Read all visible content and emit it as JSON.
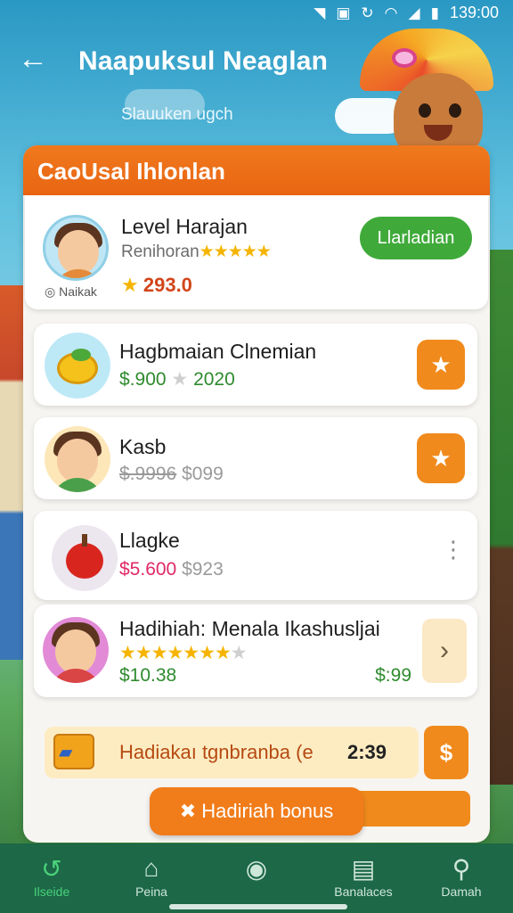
{
  "status_bar": {
    "time": "139:00",
    "icons": [
      "notification-icon",
      "app-icon",
      "sync-icon",
      "wifi-icon",
      "signal-icon",
      "battery-icon"
    ]
  },
  "header": {
    "back_icon": "arrow-left-icon",
    "title": "Naapuksul Neaglan",
    "subtitle": "Slauuken ugch"
  },
  "panel": {
    "title": "CaoUsal Ihlonlan",
    "featured": {
      "title": "Level Harajan",
      "subtitle": "Renihoran",
      "stars": "★★★★★",
      "rating_icon": "★",
      "rating": "293.0",
      "badge": "◎ Naikak",
      "button": "Llarladian"
    },
    "items": [
      {
        "title": "Hagbmaian Clnemian",
        "price": "$.900",
        "star": "★",
        "year": "2020",
        "action_icon": "★"
      },
      {
        "title": "Kasb",
        "price_old": "$.9996",
        "price_new": "$099",
        "action_icon": "★"
      },
      {
        "title": "Llagke",
        "price": "$5.600",
        "price_old": "$923",
        "action_icon": "⋮"
      },
      {
        "title": "Hadihiah: Menala Ikashusljai",
        "stars_on": "★★★★★★★",
        "stars_off": "★",
        "price": "$10.38",
        "price_right": "$:99",
        "action_icon": "›"
      }
    ],
    "bonus_bar": {
      "text": "Hadiakaı tgnbranba (e",
      "time": "2:39",
      "dollar_label": "$"
    },
    "bonus_button": {
      "icon": "✖",
      "label": "Hadiriah bonus"
    }
  },
  "bottom_nav": [
    {
      "icon": "leaf-icon",
      "label": "Ilseide",
      "active": true
    },
    {
      "icon": "home-icon",
      "label": "Peina"
    },
    {
      "icon": "circle-icon",
      "label": ""
    },
    {
      "icon": "wallet-icon",
      "label": "Banalaces"
    },
    {
      "icon": "profile-icon",
      "label": "Damah"
    }
  ],
  "colors": {
    "accent_orange": "#f08a1c",
    "header_orange": "#e96512",
    "green_button": "#3faa3a",
    "nav_bg": "#1c6847",
    "price_green": "#2e8b2e",
    "price_red": "#e02867"
  }
}
